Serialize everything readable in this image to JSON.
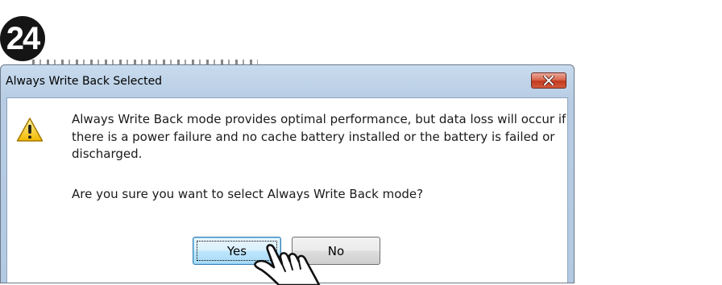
{
  "step_badge": "24",
  "dialog": {
    "title": "Always Write Back Selected",
    "message": "Always Write Back mode provides optimal performance, but data loss will occur if there is a power failure and no cache battery installed or the battery is failed or discharged.",
    "question": "Are you sure you want to select Always Write Back mode?",
    "buttons": {
      "yes": "Yes",
      "no": "No"
    }
  },
  "icons": {
    "warning": "warning-icon",
    "close": "close-icon",
    "pointer": "hand-pointer-icon"
  },
  "colors": {
    "title_bar": "#b8cde4",
    "close_button": "#c0391f",
    "warning": "#f5c400",
    "focused_button": "#bee6fd"
  }
}
